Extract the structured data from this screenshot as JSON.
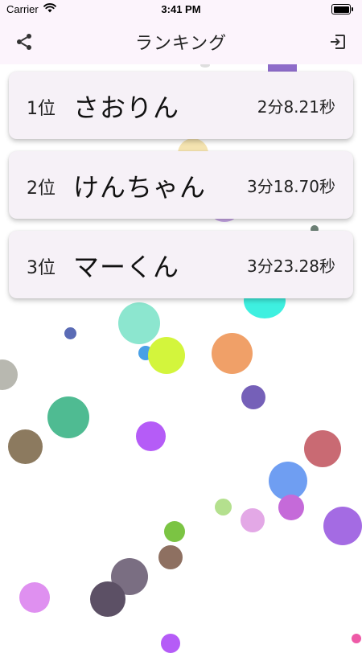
{
  "status_bar": {
    "carrier": "Carrier",
    "time": "3:41 PM",
    "wifi_icon": "wifi-icon",
    "battery_icon": "battery-icon"
  },
  "nav": {
    "title": "ランキング",
    "share_icon": "share-icon",
    "exit_icon": "exit-icon"
  },
  "rankings": [
    {
      "position": "1位",
      "name": "さおりん",
      "time": "2分8.21秒"
    },
    {
      "position": "2位",
      "name": "けんちゃん",
      "time": "3分18.70秒"
    },
    {
      "position": "3位",
      "name": "マーくん",
      "time": "3分23.28秒"
    }
  ],
  "background": {
    "decoration": "random colored bubbles",
    "colors": [
      "#8e6cc9",
      "#f4e3b0",
      "#c9a8e8",
      "#6b7f74",
      "#3ef0e0",
      "#8ce6cf",
      "#5a6bb5",
      "#49a0e6",
      "#d3f53c",
      "#f0a068",
      "#b8b8b0",
      "#7560b8",
      "#4fbb92",
      "#b55cf7",
      "#8c7a5f",
      "#c96a73",
      "#6f9ef2",
      "#c56ad9",
      "#b4e08e",
      "#e3a8e6",
      "#a46be3",
      "#7bc443",
      "#8e7061",
      "#7a6e82",
      "#df90f0",
      "#5c5065",
      "#ee5aa7"
    ]
  }
}
